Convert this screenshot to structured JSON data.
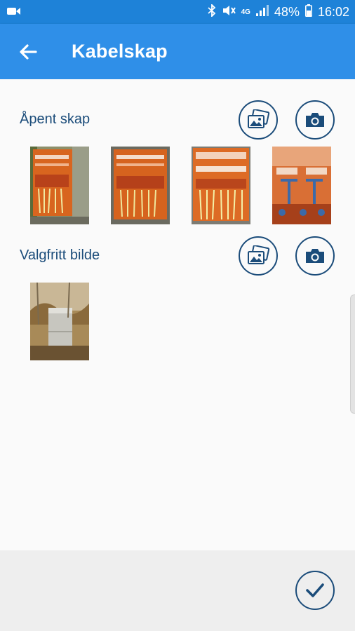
{
  "status_bar": {
    "battery": "48%",
    "time": "16:02",
    "network": "4G",
    "icons": [
      "video-camera-icon",
      "bluetooth-icon",
      "mute-icon",
      "signal-icon",
      "battery-icon"
    ]
  },
  "app_bar": {
    "title": "Kabelskap",
    "back_icon": "arrow-left-icon"
  },
  "sections": [
    {
      "title": "Åpent skap",
      "actions": [
        "gallery-icon",
        "camera-icon"
      ],
      "photo_count": 4
    },
    {
      "title": "Valgfritt bilde",
      "actions": [
        "gallery-icon",
        "camera-icon"
      ],
      "photo_count": 1
    }
  ],
  "bottom": {
    "confirm_icon": "checkmark-icon"
  },
  "colors": {
    "status_bar": "#1e82d8",
    "app_bar": "#2f8fe8",
    "accent_dark": "#1b4c7a",
    "background": "#fafafa",
    "bottom_bar": "#eeeeee"
  }
}
